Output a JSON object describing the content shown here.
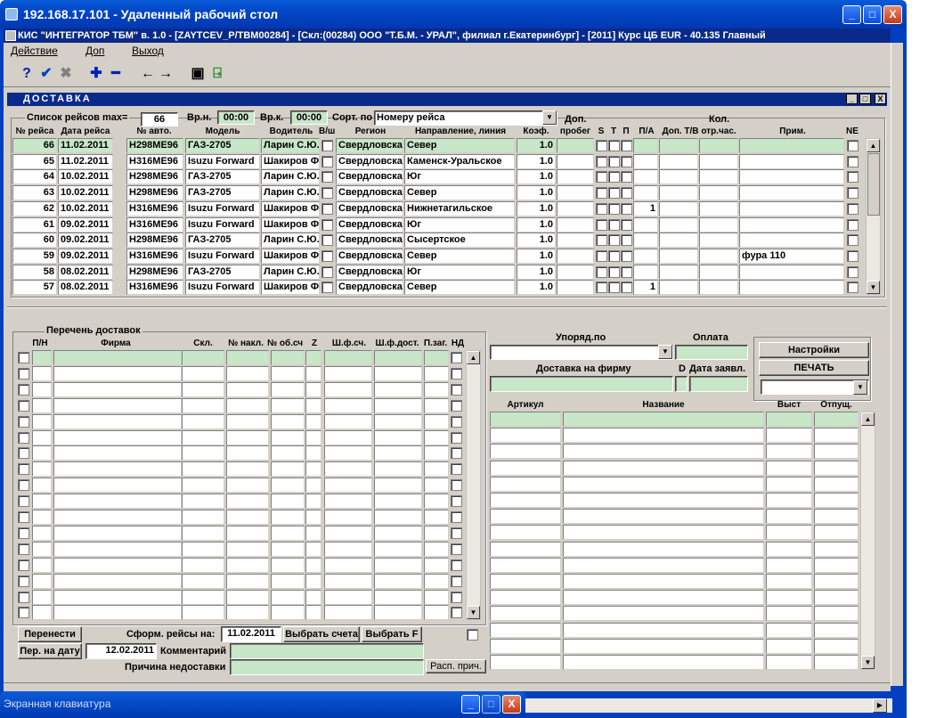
{
  "window": {
    "title": "192.168.17.101 - Удаленный рабочий стол",
    "btn_min": "_",
    "btn_max": "□",
    "btn_close": "X"
  },
  "app": {
    "title": "КИС \"ИНТЕГРАТОР ТБМ\" в. 1.0 - [ZAYTCEV_P/TBM00284] - [Скл:(00284) ООО \"Т.Б.М. - УРАЛ\", филиал г.Екатеринбург] - [2011] Курс ЦБ EUR - 40.135 Главный"
  },
  "menu": {
    "action": "Действие",
    "add": "Доп",
    "exit": "Выход"
  },
  "toolbar": {
    "help": "?",
    "ok": "✔",
    "cancel": "✖",
    "plus": "✚",
    "minus": "━",
    "back": "←",
    "fwd": "→",
    "save": "▣",
    "exit": "⍈"
  },
  "inner": {
    "title": "ДОСТАВКА",
    "min": "_",
    "max": "□",
    "close": "X"
  },
  "filter": {
    "list_label": "Список рейсов max=",
    "max": "66",
    "from_label": "Вр.н.",
    "from": "00:00",
    "to_label": "Вр.к.",
    "to": "00:00",
    "sort_label": "Сорт. по",
    "sort": "Номеру рейса",
    "dop": "Доп.",
    "kol": "Кол."
  },
  "trips": {
    "headers": [
      "№ рейса",
      "Дата рейса",
      "№ авто.",
      "Модель",
      "Водитель",
      "В/ш",
      "Регион",
      "Направление, линия",
      "Коэф.",
      "пробег",
      "S",
      "T",
      "П",
      "П/А",
      "Доп. Т/В",
      "отр.час.",
      "Прим.",
      "NE"
    ],
    "rows": [
      {
        "n": "66",
        "date": "11.02.2011",
        "car": "H298ME96",
        "model": "ГАЗ-2705",
        "driver": "Ларин С.Ю.",
        "region": "Свердловска",
        "dir": "Север",
        "k": "1.0",
        "pa": "",
        "note": ""
      },
      {
        "n": "65",
        "date": "11.02.2011",
        "car": "H316ME96",
        "model": "Isuzu Forward",
        "driver": "Шакиров Ф.",
        "region": "Свердловска",
        "dir": "Каменск-Уральское",
        "k": "1.0",
        "pa": "",
        "note": ""
      },
      {
        "n": "64",
        "date": "10.02.2011",
        "car": "H298ME96",
        "model": "ГАЗ-2705",
        "driver": "Ларин С.Ю.",
        "region": "Свердловска",
        "dir": "Юг",
        "k": "1.0",
        "pa": "",
        "note": ""
      },
      {
        "n": "63",
        "date": "10.02.2011",
        "car": "H298ME96",
        "model": "ГАЗ-2705",
        "driver": "Ларин С.Ю.",
        "region": "Свердловска",
        "dir": "Север",
        "k": "1.0",
        "pa": "",
        "note": ""
      },
      {
        "n": "62",
        "date": "10.02.2011",
        "car": "H316ME96",
        "model": "Isuzu Forward",
        "driver": "Шакиров Ф.",
        "region": "Свердловска",
        "dir": "Нижнетагильское",
        "k": "1.0",
        "pa": "1",
        "note": ""
      },
      {
        "n": "61",
        "date": "09.02.2011",
        "car": "H316ME96",
        "model": "Isuzu Forward",
        "driver": "Шакиров Ф.",
        "region": "Свердловска",
        "dir": "Юг",
        "k": "1.0",
        "pa": "",
        "note": ""
      },
      {
        "n": "60",
        "date": "09.02.2011",
        "car": "H298ME96",
        "model": "ГАЗ-2705",
        "driver": "Ларин С.Ю.",
        "region": "Свердловска",
        "dir": "Сысертское",
        "k": "1.0",
        "pa": "",
        "note": ""
      },
      {
        "n": "59",
        "date": "09.02.2011",
        "car": "H316ME96",
        "model": "Isuzu Forward",
        "driver": "Шакиров Ф.",
        "region": "Свердловска",
        "dir": "Север",
        "k": "1.0",
        "pa": "",
        "note": "фура 110"
      },
      {
        "n": "58",
        "date": "08.02.2011",
        "car": "H298ME96",
        "model": "ГАЗ-2705",
        "driver": "Ларин С.Ю.",
        "region": "Свердловска",
        "dir": "Юг",
        "k": "1.0",
        "pa": "",
        "note": ""
      },
      {
        "n": "57",
        "date": "08.02.2011",
        "car": "H316ME96",
        "model": "Isuzu Forward",
        "driver": "Шакиров Ф.",
        "region": "Свердловска",
        "dir": "Север",
        "k": "1.0",
        "pa": "1",
        "note": ""
      }
    ]
  },
  "deliveries": {
    "title": "Перечень доставок",
    "headers": [
      "П/Н",
      "Фирма",
      "Скл.",
      "№ накл.",
      "№ об.сч.",
      "Z",
      "Ш.ф.сч.",
      "Ш.ф.дост.",
      "П.заг.",
      "НД"
    ]
  },
  "right": {
    "order_label": "Упоряд.по",
    "pay_label": "Оплата",
    "deliv_label": "Доставка на фирму",
    "d_label": "D",
    "date_label": "Дата заявл.",
    "settings": "Настройки",
    "print": "ПЕЧАТЬ",
    "items_headers": [
      "Артикул",
      "Название",
      "Выст",
      "Отпущ."
    ]
  },
  "bottom": {
    "move": "Перенести",
    "form_label": "Сформ. рейсы на:",
    "form_date": "11.02.2011",
    "choose_acc": "Выбрать счета",
    "choose_f": "Выбрать F",
    "move_date": "Пер. на дату",
    "move_date_val": "12.02.2011",
    "comment_label": "Комментарий",
    "reason_label": "Причина недоставки",
    "reason_btn": "Расп. прич."
  },
  "keyboard": {
    "title": "Экранная клавиатура"
  }
}
